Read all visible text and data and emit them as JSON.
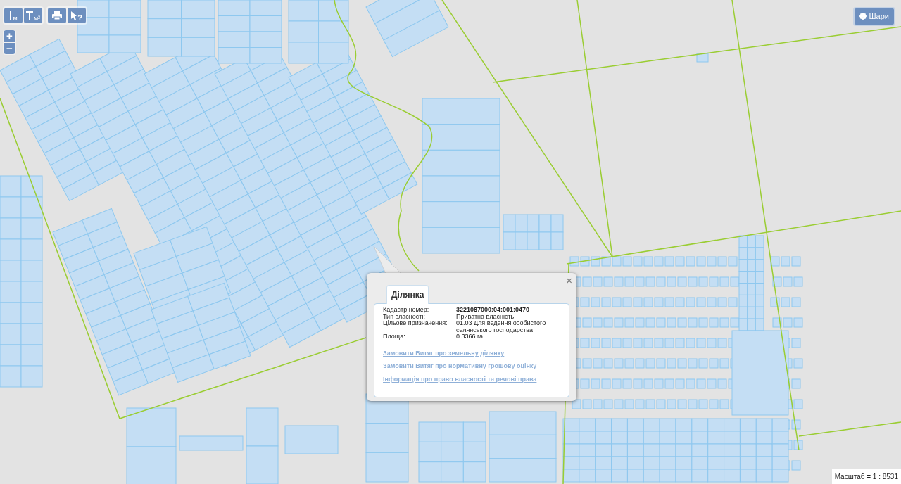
{
  "toolbar_groups": [
    {
      "tools": [
        {
          "kind": "length",
          "label": "м"
        },
        {
          "kind": "area",
          "label": "м²"
        }
      ]
    },
    {
      "tools": [
        {
          "kind": "print"
        },
        {
          "kind": "identify",
          "label": "?"
        }
      ]
    }
  ],
  "zoom_buttons": [
    {
      "kind": "in",
      "label": "+"
    },
    {
      "kind": "out",
      "label": "−"
    }
  ],
  "layers_button": {
    "label": "Шари"
  },
  "popup": {
    "close": "×",
    "tabs": [
      {
        "label": "Ділянка",
        "selected": true
      }
    ],
    "fields": [
      {
        "label": "Кадастр.номер:",
        "value": "3221087000:04:001:0470",
        "emphasis": true
      },
      {
        "label": "Тип власності:",
        "value": "Приватна власність",
        "emphasis": false
      },
      {
        "label": "Цільове призначення:",
        "value": "01.03 Для ведення особистого селянського господарства",
        "emphasis": false
      },
      {
        "label": "Площа:",
        "value": "0.3366 га",
        "emphasis": false
      }
    ],
    "links": [
      "Замовити Витяг про земельну ділянку",
      "Замовити Витяг про нормативну грошову оцінку",
      "Інформація про право власності та речові права"
    ]
  },
  "scale": "Масштаб = 1 : 8531"
}
